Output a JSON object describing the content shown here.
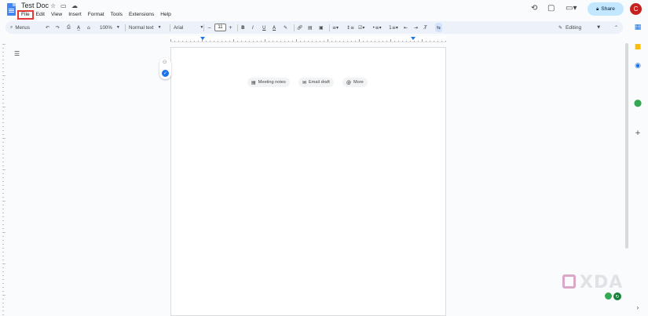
{
  "doc": {
    "title": "Test Doc",
    "title_icons": [
      "star-icon",
      "move-folder-icon",
      "cloud-saved-icon"
    ]
  },
  "menu": [
    {
      "label": "File",
      "highlighted": true
    },
    {
      "label": "Edit"
    },
    {
      "label": "View"
    },
    {
      "label": "Insert"
    },
    {
      "label": "Format"
    },
    {
      "label": "Tools"
    },
    {
      "label": "Extensions"
    },
    {
      "label": "Help"
    }
  ],
  "header_actions": {
    "share_label": "Share",
    "avatar_initial": "C",
    "avatar_color": "#c5221f",
    "share_color": "#c2e7ff"
  },
  "toolbar": {
    "menus_label": "Menus",
    "zoom": "100%",
    "style": "Normal text",
    "font": "Arial",
    "font_size": "11",
    "mode": "Editing"
  },
  "page_chips": [
    {
      "label": "Meeting notes",
      "icon": "document-icon"
    },
    {
      "label": "Email draft",
      "icon": "email-icon"
    },
    {
      "label": "More",
      "icon": "at-icon"
    }
  ],
  "watermark": "XDA",
  "colors": {
    "accent": "#1a73e8",
    "toolbar_bg": "#edf2fa",
    "page_bg": "#f9fbfd",
    "highlight": "#e53935"
  }
}
